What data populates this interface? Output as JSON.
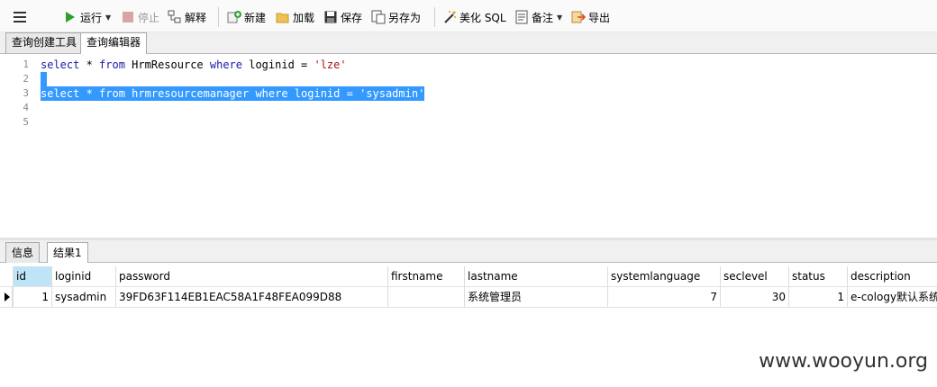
{
  "toolbar": {
    "run_label": "运行",
    "stop_label": "停止",
    "explain_label": "解释",
    "new_label": "新建",
    "load_label": "加载",
    "save_label": "保存",
    "saveas_label": "另存为",
    "beautify_label": "美化 SQL",
    "notes_label": "备注",
    "export_label": "导出"
  },
  "tabs": {
    "builder": "查询创建工具",
    "editor": "查询编辑器"
  },
  "editor": {
    "line_numbers": [
      "1",
      "2",
      "3",
      "4",
      "5"
    ],
    "line1": {
      "kw1": "select",
      "t1": " * ",
      "kw2": "from",
      "t2": " HrmResource ",
      "kw3": "where",
      "t3": " loginid = ",
      "str": "'lze'"
    },
    "line3": {
      "kw1": "select",
      "t1": " * ",
      "kw2": "from",
      "t2": " hrmresourcemanager ",
      "kw3": "where",
      "t3": " loginid = ",
      "str": "'sysadmin'"
    }
  },
  "result_tabs": {
    "info": "信息",
    "result1": "结果1"
  },
  "grid": {
    "columns": [
      "id",
      "loginid",
      "password",
      "firstname",
      "lastname",
      "systemlanguage",
      "seclevel",
      "status",
      "description"
    ],
    "row": {
      "id": "1",
      "loginid": "sysadmin",
      "password": "39FD63F114EB1EAC58A1F48FEA099D88",
      "firstname": "",
      "lastname": "系统管理员",
      "systemlanguage": "7",
      "seclevel": "30",
      "status": "1",
      "description": "e-cology默认系统"
    }
  },
  "watermark": "www.wooyun.org"
}
